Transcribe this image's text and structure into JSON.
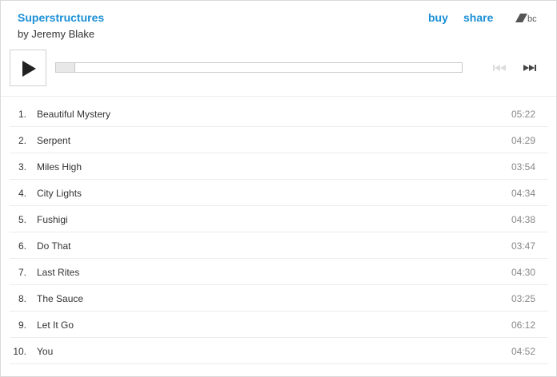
{
  "album": {
    "title": "Superstructures",
    "artist_line": "by Jeremy Blake"
  },
  "header": {
    "buy_label": "buy",
    "share_label": "share",
    "logo_icon": "bandcamp-logo-icon"
  },
  "player": {
    "play_icon": "play-icon",
    "prev_icon": "previous-track-icon",
    "next_icon": "next-track-icon",
    "progress_fraction": 0.0,
    "prev_enabled": false
  },
  "colors": {
    "accent": "#1a8fd6",
    "text": "#333333",
    "muted": "#888888",
    "border": "#d9d9d9"
  },
  "tracks": [
    {
      "num": "1.",
      "title": "Beautiful Mystery",
      "duration": "05:22"
    },
    {
      "num": "2.",
      "title": "Serpent",
      "duration": "04:29"
    },
    {
      "num": "3.",
      "title": "Miles High",
      "duration": "03:54"
    },
    {
      "num": "4.",
      "title": "City Lights",
      "duration": "04:34"
    },
    {
      "num": "5.",
      "title": "Fushigi",
      "duration": "04:38"
    },
    {
      "num": "6.",
      "title": "Do That",
      "duration": "03:47"
    },
    {
      "num": "7.",
      "title": "Last Rites",
      "duration": "04:30"
    },
    {
      "num": "8.",
      "title": "The Sauce",
      "duration": "03:25"
    },
    {
      "num": "9.",
      "title": "Let It Go",
      "duration": "06:12"
    },
    {
      "num": "10.",
      "title": "You",
      "duration": "04:52"
    }
  ]
}
